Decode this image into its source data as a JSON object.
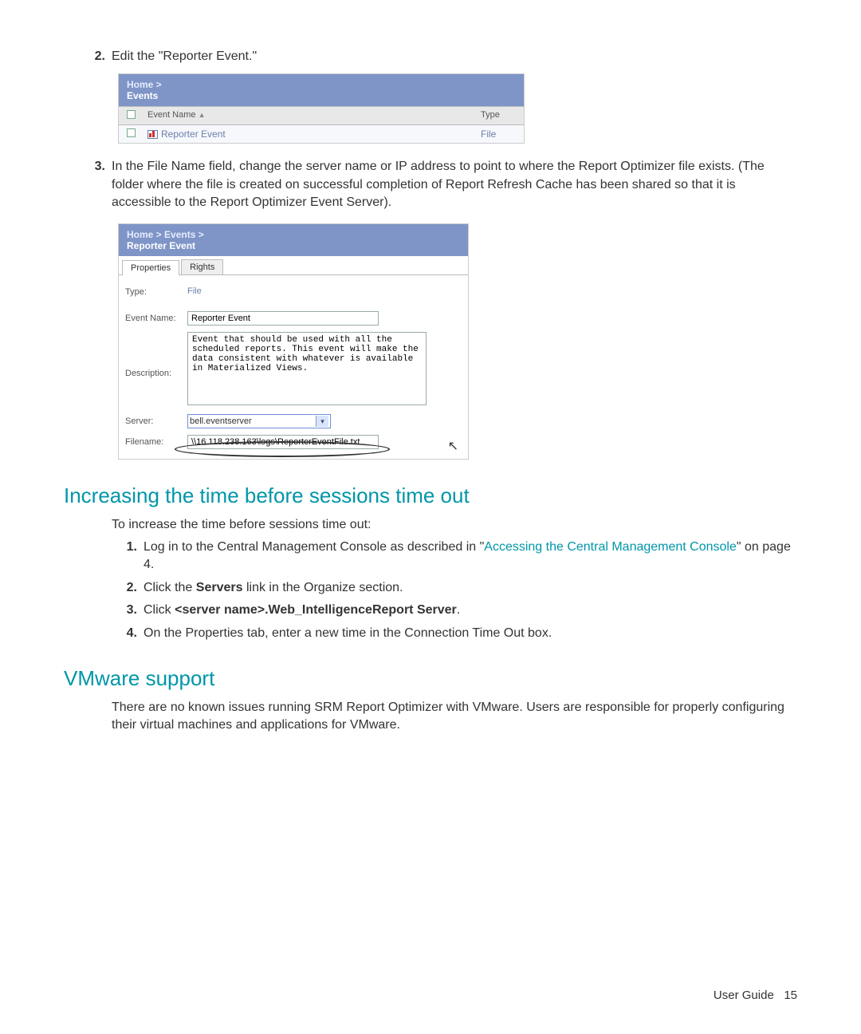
{
  "steps_top": {
    "num2": "2.",
    "text2": "Edit the \"Reporter Event.\"",
    "num3": "3.",
    "text3": "In the File Name field, change the server name or IP address to point to where the Report Optimizer file exists. (The folder where the file is created on successful completion of Report Refresh Cache has been shared so that it is accessible to the Report Optimizer Event Server)."
  },
  "shot1": {
    "bc_home": "Home >",
    "bc_events": "Events",
    "col_name": "Event Name",
    "col_type": "Type",
    "row_name": "Reporter Event",
    "row_type": "File"
  },
  "shot2": {
    "bc": "Home > Events >",
    "title": "Reporter Event",
    "tab_props": "Properties",
    "tab_rights": "Rights",
    "lbl_type": "Type:",
    "val_type": "File",
    "lbl_name": "Event Name:",
    "val_name": "Reporter Event",
    "lbl_desc": "Description:",
    "val_desc": "Event that should be used with all the scheduled reports. This event will make the data consistent with whatever is available in Materialized Views.",
    "lbl_server": "Server:",
    "val_server": "bell.eventserver",
    "lbl_file": "Filename:",
    "val_file": "\\\\16.118.238.163\\logs\\ReporterEventFile.txt"
  },
  "sec1": {
    "heading": "Increasing the time before sessions time out",
    "intro": "To increase the time before sessions time out:",
    "n1": "1.",
    "t1a": "Log in to the Central Management Console as described in \"",
    "t1link": "Accessing the Central Management Console",
    "t1b": "\" on page 4.",
    "n2": "2.",
    "t2a": "Click the ",
    "t2b": "Servers",
    "t2c": " link in the Organize section.",
    "n3": "3.",
    "t3a": "Click ",
    "t3b": "<server name>.Web_IntelligenceReport Server",
    "t3c": ".",
    "n4": "4.",
    "t4": "On the Properties tab, enter a new time in the Connection Time Out box."
  },
  "sec2": {
    "heading": "VMware support",
    "body": "There are no known issues running SRM Report Optimizer with VMware. Users are responsible for properly configuring their virtual machines and applications for VMware."
  },
  "footer": {
    "label": "User Guide",
    "page": "15"
  }
}
